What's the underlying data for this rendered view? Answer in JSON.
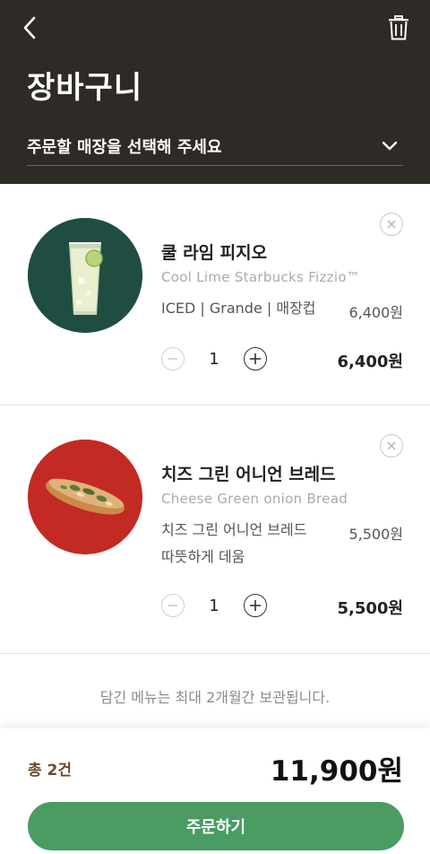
{
  "header": {
    "title": "장바구니",
    "store_placeholder": "주문할 매장을 선택해 주세요",
    "back_icon": "chevron-left-icon",
    "trash_icon": "trash-icon"
  },
  "items": [
    {
      "name": "쿨 라임 피지오",
      "en_name": "Cool Lime Starbucks Fizzio™",
      "option": "ICED | Grande | 매장컵",
      "unit_price": "6,400원",
      "quantity": "1",
      "line_total": "6,400원"
    },
    {
      "name": "치즈 그린 어니언 브레드",
      "en_name": "Cheese Green onion Bread",
      "option_line1": "치즈 그린 어니언 브레드",
      "option_line2": "따뜻하게 데움",
      "unit_price": "5,500원",
      "quantity": "1",
      "line_total": "5,500원"
    }
  ],
  "notice": "담긴 메뉴는 최대 2개월간 보관됩니다.",
  "footer": {
    "count": "총 2건",
    "total": "11,900원",
    "order_button": "주문하기"
  },
  "colors": {
    "header_bg": "#2e2a26",
    "order_button": "#4a9c62",
    "count_text": "#6b4c2c"
  }
}
